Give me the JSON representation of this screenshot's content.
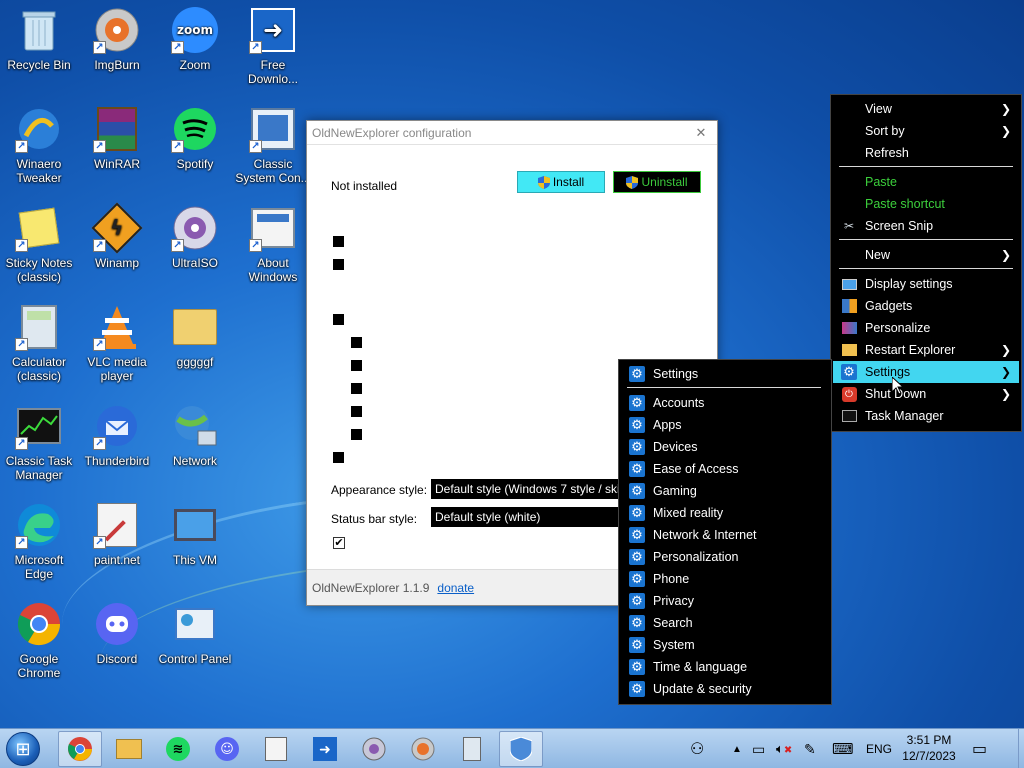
{
  "desktop_icons": [
    {
      "label": "Recycle Bin",
      "icon": "recycle-bin-icon"
    },
    {
      "label": "ImgBurn",
      "icon": "disc-burn-icon"
    },
    {
      "label": "Zoom",
      "icon": "zoom-icon"
    },
    {
      "label": "Free Downlo...",
      "icon": "download-manager-icon"
    },
    {
      "label": "Winaero Tweaker",
      "icon": "winaero-icon"
    },
    {
      "label": "WinRAR",
      "icon": "winrar-icon"
    },
    {
      "label": "Spotify",
      "icon": "spotify-icon"
    },
    {
      "label": "Classic System Con...",
      "icon": "system-config-icon"
    },
    {
      "label": "Sticky Notes (classic)",
      "icon": "sticky-notes-icon"
    },
    {
      "label": "Winamp",
      "icon": "winamp-icon"
    },
    {
      "label": "UltraISO",
      "icon": "ultraiso-icon"
    },
    {
      "label": "About Windows",
      "icon": "about-windows-icon"
    },
    {
      "label": "Calculator (classic)",
      "icon": "calculator-icon"
    },
    {
      "label": "VLC media player",
      "icon": "vlc-icon"
    },
    {
      "label": "gggggf",
      "icon": "folder-user-icon"
    },
    {
      "label": "Classic Task Manager",
      "icon": "task-manager-icon"
    },
    {
      "label": "Thunderbird",
      "icon": "thunderbird-icon"
    },
    {
      "label": "Network",
      "icon": "network-icon"
    },
    {
      "label": "Microsoft Edge",
      "icon": "edge-icon"
    },
    {
      "label": "paint.net",
      "icon": "paintnet-icon"
    },
    {
      "label": "This VM",
      "icon": "computer-icon"
    },
    {
      "label": "Google Chrome",
      "icon": "chrome-icon"
    },
    {
      "label": "Discord",
      "icon": "discord-icon"
    },
    {
      "label": "Control Panel",
      "icon": "control-panel-icon"
    }
  ],
  "config_window": {
    "title": "OldNewExplorer configuration",
    "close_glyph": "✕",
    "status": "Not installed",
    "install_label": "Install",
    "uninstall_label": "Uninstall",
    "appearance_label": "Appearance style:",
    "appearance_value": "Default style (Windows 7 style / ski",
    "statusbar_label": "Status bar style:",
    "statusbar_value": "Default style (white)",
    "checkbox_mark": "✔",
    "version": "OldNewExplorer 1.1.9",
    "donate_label": "donate"
  },
  "desktop_menu": {
    "items": [
      {
        "label": "View",
        "submenu": true
      },
      {
        "label": "Sort by",
        "submenu": true
      },
      {
        "label": "Refresh"
      },
      {
        "label": "Paste",
        "green": true
      },
      {
        "label": "Paste shortcut",
        "green": true
      },
      {
        "label": "Screen Snip",
        "icon": "scissors-icon"
      },
      {
        "label": "New",
        "submenu": true
      },
      {
        "label": "Display settings",
        "icon": "display-icon"
      },
      {
        "label": "Gadgets",
        "icon": "gadgets-icon"
      },
      {
        "label": "Personalize",
        "icon": "personalize-icon"
      },
      {
        "label": "Restart Explorer",
        "icon": "folder-icon",
        "submenu": true
      },
      {
        "label": "Settings",
        "icon": "gear-icon",
        "submenu": true,
        "highlighted": true
      },
      {
        "label": "Shut Down",
        "icon": "power-icon",
        "submenu": true
      },
      {
        "label": "Task Manager",
        "icon": "task-manager-icon"
      }
    ]
  },
  "settings_menu": {
    "items": [
      "Settings",
      "Accounts",
      "Apps",
      "Devices",
      "Ease of Access",
      "Gaming",
      "Mixed reality",
      "Network & Internet",
      "Personalization",
      "Phone",
      "Privacy",
      "Search",
      "System",
      "Time & language",
      "Update & security"
    ]
  },
  "taskbar": {
    "apps": [
      {
        "icon": "chrome-icon",
        "active": true
      },
      {
        "icon": "file-explorer-icon"
      },
      {
        "icon": "spotify-icon"
      },
      {
        "icon": "discord-icon"
      },
      {
        "icon": "paintnet-icon"
      },
      {
        "icon": "download-manager-icon"
      },
      {
        "icon": "ultraiso-icon"
      },
      {
        "icon": "imgburn-icon"
      },
      {
        "icon": "calculator-icon"
      },
      {
        "icon": "shield-app-icon",
        "active": true
      }
    ],
    "language": "ENG",
    "time": "3:51 PM",
    "date": "12/7/2023"
  },
  "colors": {
    "menu_highlight": "#42d6f0",
    "menu_green": "#3ccf3c",
    "install_bg": "#42e8f5",
    "gear_blue": "#1a74d0"
  }
}
